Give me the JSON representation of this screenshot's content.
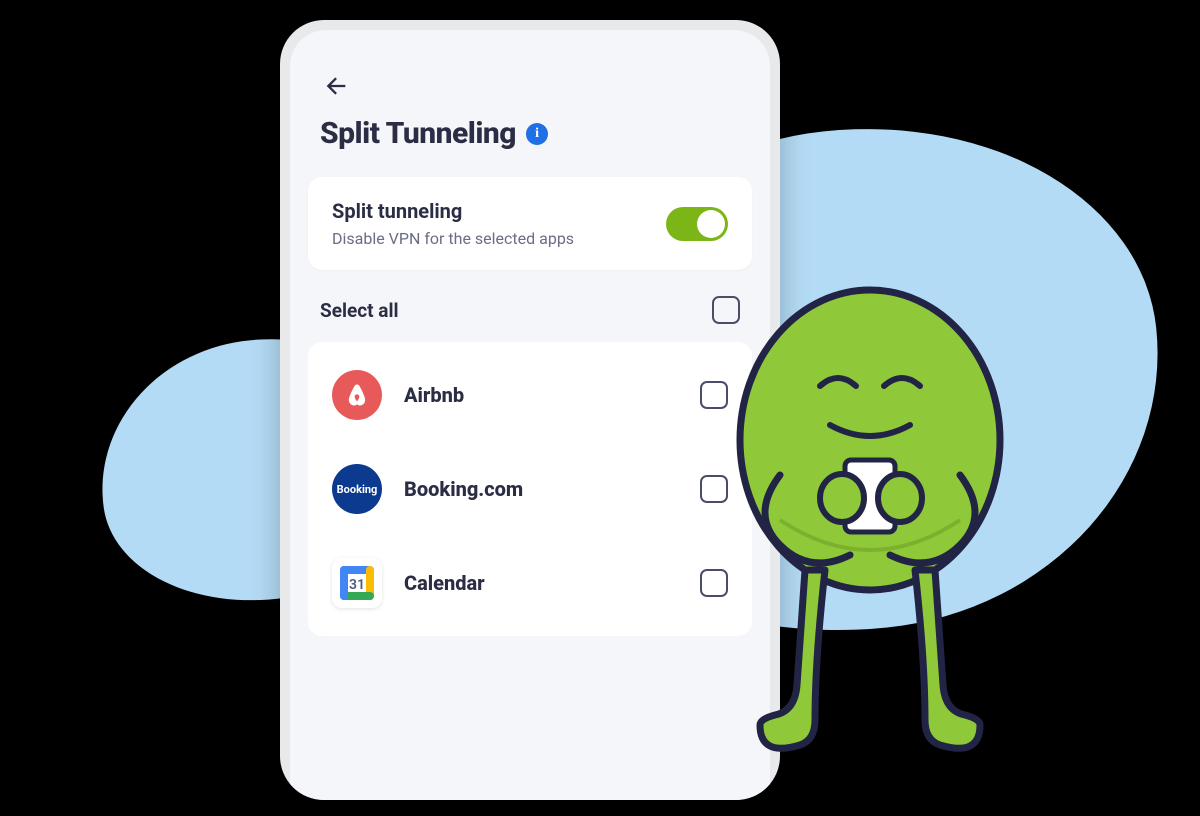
{
  "header": {
    "title": "Split Tunneling"
  },
  "feature_card": {
    "title": "Split tunneling",
    "subtitle": "Disable VPN for the selected apps",
    "toggle_on": true
  },
  "select_all": {
    "label": "Select all",
    "checked": false
  },
  "apps": [
    {
      "name": "Airbnb",
      "icon": "airbnb",
      "checked": false
    },
    {
      "name": "Booking.com",
      "icon": "booking",
      "checked": false
    },
    {
      "name": "Calendar",
      "icon": "calendar",
      "checked": false
    }
  ],
  "icons": {
    "back": "back-arrow-icon",
    "info": "info-icon"
  },
  "colors": {
    "blob": "#b4dbf5",
    "accent_green": "#7cb518",
    "text_primary": "#2b2d45",
    "text_secondary": "#6a6d85",
    "airbnb": "#e85a5a",
    "booking": "#0b3a8f",
    "info_blue": "#1f6fe6",
    "mascot_body": "#8fc93a",
    "mascot_outline": "#222445"
  }
}
